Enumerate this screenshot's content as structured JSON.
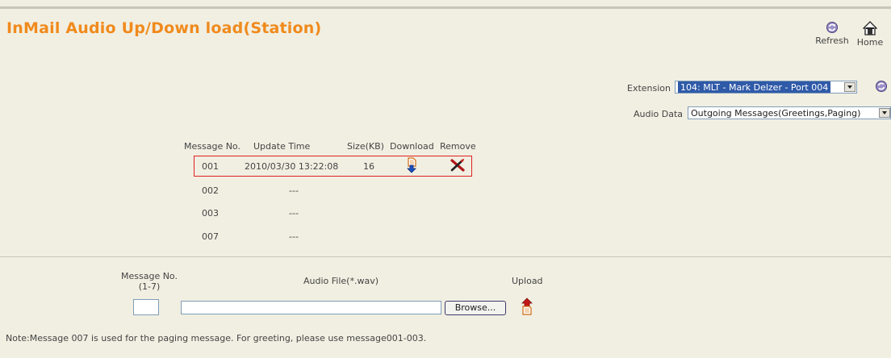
{
  "page": {
    "title": "InMail Audio Up/Down load(Station)"
  },
  "toolbar": {
    "refresh_label": "Refresh",
    "home_label": "Home"
  },
  "filters": {
    "extension_label": "Extension",
    "extension_value": "104: MLT - Mark Delzer - Port 004",
    "audio_data_label": "Audio Data",
    "audio_data_value": "Outgoing Messages(Greetings,Paging)"
  },
  "messages_table": {
    "headers": {
      "message_no": "Message No.",
      "update_time": "Update Time",
      "size": "Size(KB)",
      "download": "Download",
      "remove": "Remove"
    },
    "rows": [
      {
        "message_no": "001",
        "update_time": "2010/03/30 13:22:08",
        "size": "16"
      },
      {
        "message_no": "002",
        "update_time": "---",
        "size": ""
      },
      {
        "message_no": "003",
        "update_time": "---",
        "size": ""
      },
      {
        "message_no": "007",
        "update_time": "---",
        "size": ""
      }
    ]
  },
  "upload": {
    "message_no_label": "Message No.",
    "message_no_range": "(1-7)",
    "message_no_value": "",
    "audio_file_label": "Audio File(*.wav)",
    "audio_file_value": "",
    "browse_label": "Browse...",
    "upload_label": "Upload"
  },
  "note": "Note:Message 007 is used for the paging message. For greeting, please use message001-003.",
  "colors": {
    "title": "#f08a1c",
    "background": "#f1efe2",
    "highlight_border": "#e02020"
  }
}
